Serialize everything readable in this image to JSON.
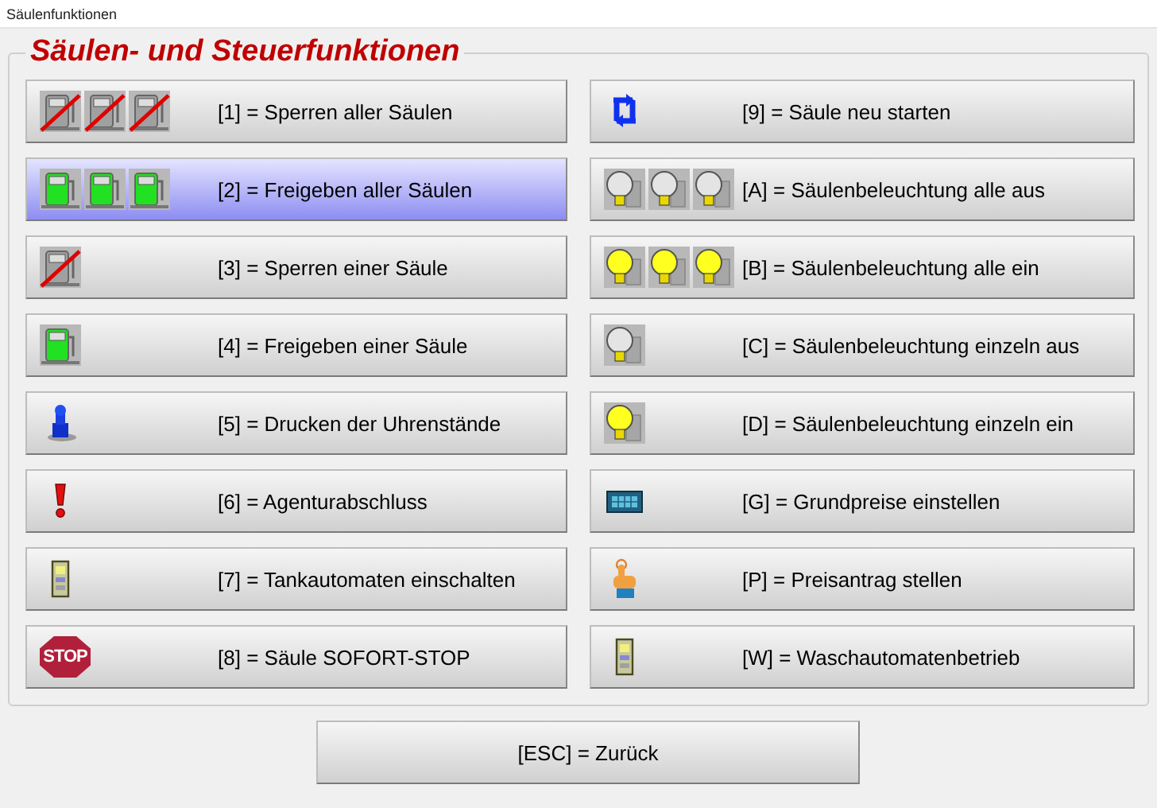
{
  "window": {
    "title": "Säulenfunktionen"
  },
  "group": {
    "title": "Säulen- und Steuerfunktionen"
  },
  "columns": [
    {
      "buttons": [
        {
          "label": "[1] = Sperren aller Säulen",
          "selected": false,
          "icons": [
            {
              "kind": "pump",
              "blocked": true
            },
            {
              "kind": "pump",
              "blocked": true
            },
            {
              "kind": "pump",
              "blocked": true
            }
          ]
        },
        {
          "label": "[2] = Freigeben aller Säulen",
          "selected": true,
          "icons": [
            {
              "kind": "pump",
              "blocked": false
            },
            {
              "kind": "pump",
              "blocked": false
            },
            {
              "kind": "pump",
              "blocked": false
            }
          ]
        },
        {
          "label": "[3] = Sperren einer Säule",
          "selected": false,
          "icons": [
            {
              "kind": "pump",
              "blocked": true
            }
          ]
        },
        {
          "label": "[4] = Freigeben einer Säule",
          "selected": false,
          "icons": [
            {
              "kind": "pump",
              "blocked": false
            }
          ]
        },
        {
          "label": "[5] = Drucken der Uhrenstände",
          "selected": false,
          "icons": [
            {
              "kind": "figure"
            }
          ]
        },
        {
          "label": "[6] = Agenturabschluss",
          "selected": false,
          "icons": [
            {
              "kind": "exclamation"
            }
          ]
        },
        {
          "label": "[7] = Tankautomaten einschalten",
          "selected": false,
          "icons": [
            {
              "kind": "machine"
            }
          ]
        },
        {
          "label": "[8] = Säule SOFORT-STOP",
          "selected": false,
          "icons": [
            {
              "kind": "stop",
              "text": "STOP"
            }
          ]
        }
      ]
    },
    {
      "buttons": [
        {
          "label": "[9] = Säule neu starten",
          "selected": false,
          "icons": [
            {
              "kind": "restart"
            }
          ]
        },
        {
          "label": "[A] = Säulenbeleuchtung alle aus",
          "selected": false,
          "icons": [
            {
              "kind": "bulb",
              "on": false
            },
            {
              "kind": "bulb",
              "on": false
            },
            {
              "kind": "bulb",
              "on": false
            }
          ]
        },
        {
          "label": "[B] = Säulenbeleuchtung alle ein",
          "selected": false,
          "icons": [
            {
              "kind": "bulb",
              "on": true
            },
            {
              "kind": "bulb",
              "on": true
            },
            {
              "kind": "bulb",
              "on": true
            }
          ]
        },
        {
          "label": "[C] = Säulenbeleuchtung einzeln aus",
          "selected": false,
          "icons": [
            {
              "kind": "bulb",
              "on": false
            }
          ]
        },
        {
          "label": "[D] = Säulenbeleuchtung einzeln ein",
          "selected": false,
          "icons": [
            {
              "kind": "bulb",
              "on": true
            }
          ]
        },
        {
          "label": "[G] = Grundpreise einstellen",
          "selected": false,
          "icons": [
            {
              "kind": "keypad"
            }
          ]
        },
        {
          "label": "[P] = Preisantrag stellen",
          "selected": false,
          "icons": [
            {
              "kind": "hand"
            }
          ]
        },
        {
          "label": "[W] = Waschautomatenbetrieb",
          "selected": false,
          "icons": [
            {
              "kind": "machine"
            }
          ]
        }
      ]
    }
  ],
  "back_button": {
    "label": "[ESC] = Zurück",
    "selected": false
  }
}
